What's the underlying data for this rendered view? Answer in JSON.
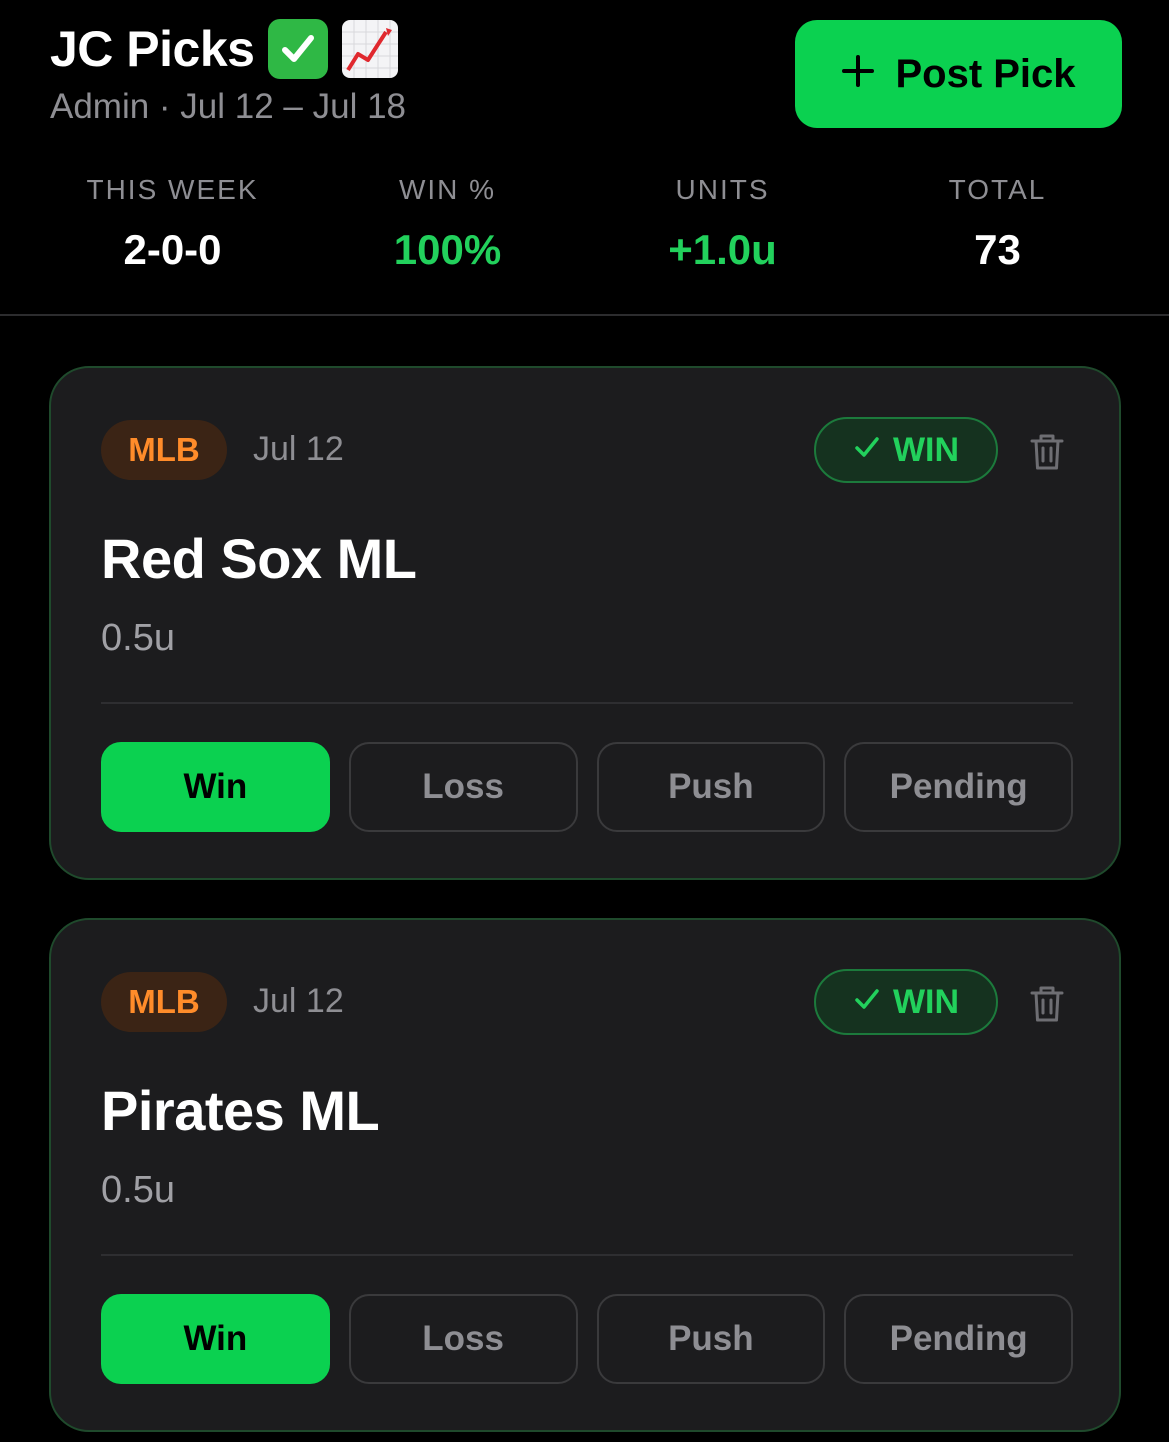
{
  "header": {
    "title": "JC Picks",
    "title_emojis": [
      "check-mark-button-emoji",
      "chart-increasing-emoji"
    ],
    "subtitle": "Admin · Jul 12 – Jul 18",
    "post_button": {
      "icon": "plus",
      "label": "Post Pick"
    }
  },
  "stats": [
    {
      "label": "THIS WEEK",
      "value": "2-0-0"
    },
    {
      "label": "WIN %",
      "value": "100%"
    },
    {
      "label": "UNITS",
      "value": "+1.0u"
    },
    {
      "label": "TOTAL",
      "value": "73"
    }
  ],
  "picks": [
    {
      "league": "MLB",
      "date": "Jul 12",
      "result_badge": "WIN",
      "name": "Red Sox ML",
      "units": "0.5u",
      "buttons": [
        "Win",
        "Loss",
        "Push",
        "Pending"
      ],
      "selected": "Win"
    },
    {
      "league": "MLB",
      "date": "Jul 12",
      "result_badge": "WIN",
      "name": "Pirates ML",
      "units": "0.5u",
      "buttons": [
        "Win",
        "Loss",
        "Push",
        "Pending"
      ],
      "selected": "Win"
    }
  ],
  "colors": {
    "background": "#000000",
    "card": "#1c1c1e",
    "accent_green": "#0bd150",
    "win_text": "#22d15c",
    "league_orange": "#ff8c2a",
    "muted": "#8e8e93"
  }
}
